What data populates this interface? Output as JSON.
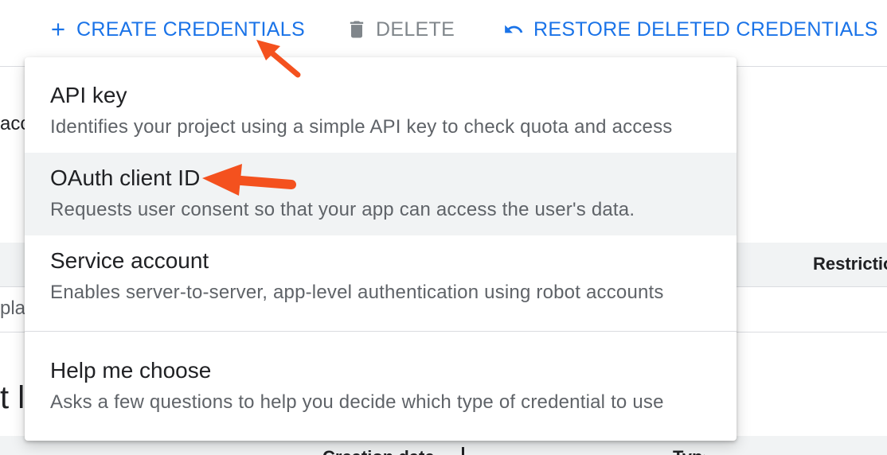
{
  "toolbar": {
    "create_label": "CREATE CREDENTIALS",
    "delete_label": "DELETE",
    "restore_label": "RESTORE DELETED CREDENTIALS",
    "create_icon": "plus-icon",
    "delete_icon": "trash-icon",
    "restore_icon": "undo-icon",
    "primary_color": "#1a73e8",
    "disabled_color": "#80868b"
  },
  "background": {
    "fragment_1": "acc",
    "column_header_restrictions": "Restrictions",
    "fragment_2": "pla",
    "fragment_3": "t l",
    "bottom_header_1": "Creation date",
    "bottom_header_2": "Type"
  },
  "menu": {
    "items": [
      {
        "title": "API key",
        "description": "Identifies your project using a simple API key to check quota and access"
      },
      {
        "title": "OAuth client ID",
        "description": "Requests user consent so that your app can access the user's data."
      },
      {
        "title": "Service account",
        "description": "Enables server-to-server, app-level authentication using robot accounts"
      },
      {
        "title": "Help me choose",
        "description": "Asks a few questions to help you decide which type of credential to use"
      }
    ],
    "highlighted_index": 1,
    "highlight_color": "#f1f3f4"
  },
  "annotations": {
    "arrow_color": "#f4511e"
  }
}
